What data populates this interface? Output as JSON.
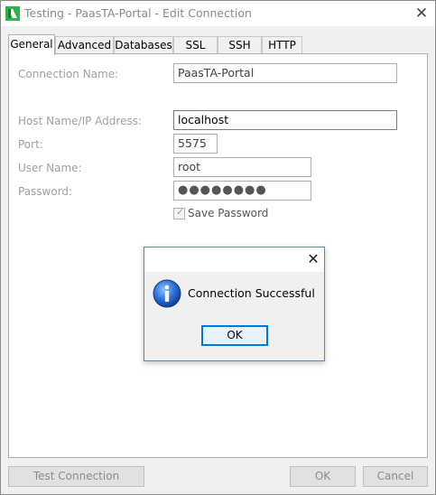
{
  "window": {
    "title": "Testing - PaasTA-Portal - Edit Connection"
  },
  "tabs": [
    {
      "label": "General",
      "active": true
    },
    {
      "label": "Advanced"
    },
    {
      "label": "Databases"
    },
    {
      "label": "SSL"
    },
    {
      "label": "SSH"
    },
    {
      "label": "HTTP"
    }
  ],
  "form": {
    "connection_name": {
      "label": "Connection Name:",
      "value": "PaasTA-Portal"
    },
    "host": {
      "label": "Host Name/IP Address:",
      "value": "localhost"
    },
    "port": {
      "label": "Port:",
      "value": "5575"
    },
    "user": {
      "label": "User Name:",
      "value": "root"
    },
    "password": {
      "label": "Password:",
      "value": "●●●●●●●●"
    },
    "save_password": {
      "label": "Save Password",
      "checked": true
    }
  },
  "buttons": {
    "test_connection": "Test Connection",
    "ok": "OK",
    "cancel": "Cancel"
  },
  "dialog": {
    "message": "Connection Successful",
    "ok": "OK",
    "icon": "info-icon"
  },
  "colors": {
    "accent": "#0078d7",
    "app_icon_green": "#2fb34a",
    "info_blue": "#1a56b8"
  }
}
